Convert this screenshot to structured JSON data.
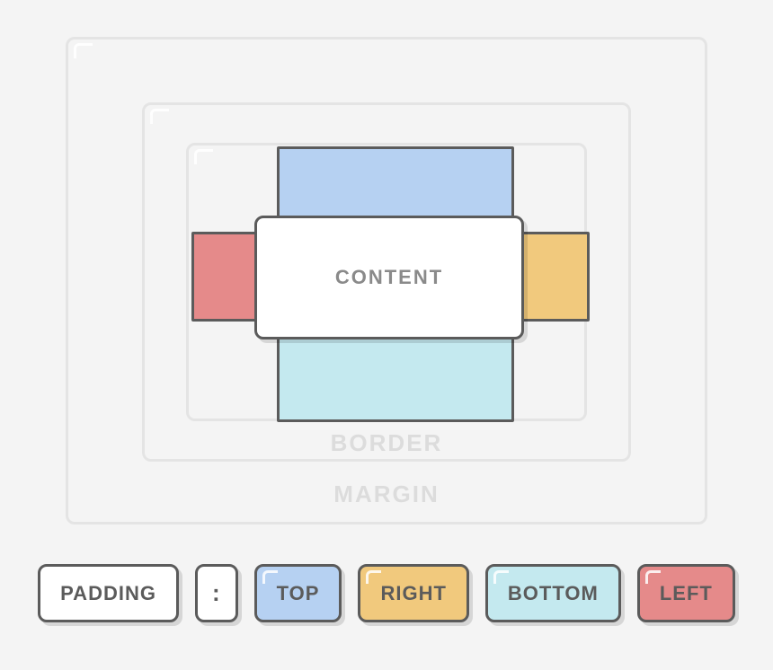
{
  "labels": {
    "content": "CONTENT",
    "border": "BORDER",
    "margin": "MARGIN"
  },
  "legend": {
    "property": "PADDING",
    "separator": ":",
    "top": "TOP",
    "right": "RIGHT",
    "bottom": "BOTTOM",
    "left": "LEFT"
  },
  "colors": {
    "top": "#b6d1f2",
    "right": "#f1c97d",
    "bottom": "#c4e9ef",
    "left": "#e58a8a",
    "outline": "#5b5b5b",
    "faded_outline": "#e4e4e4",
    "bg": "#f4f4f4",
    "ghost_text": "#dcdcdc"
  }
}
